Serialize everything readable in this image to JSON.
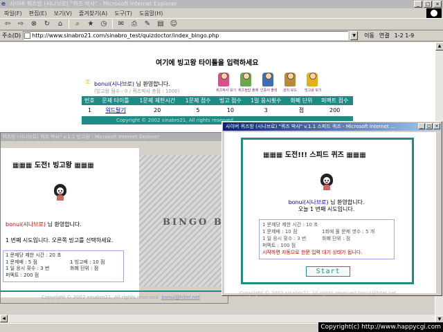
{
  "browser": {
    "title": "사이버 퀴즈방 (시나브로) \"퀴즈 박사\" - Microsoft Internet Explorer",
    "menu": [
      "파일(F)",
      "편집(E)",
      "보기(V)",
      "즐겨찾기(A)",
      "도구(T)",
      "도움말(H)"
    ],
    "address_label": "주소(D)",
    "address_url": "http://www.sinabro21.com/sinabro_test/quizdoctor/index_bingo.php",
    "go_label": "이동",
    "links_label": "연결",
    "links_extra": "1-2  1-9"
  },
  "main": {
    "title": "여기에 빙고왕 타이틀을 입력하세요",
    "user_name": "bonui(시나브로)",
    "user_greeting_suffix": " 님 환영합니다.",
    "user_score": "(빙고왕 점수 : 0 / 퀴즈박사 총점 : 1000)",
    "icons": [
      {
        "name": "quiz-doctor-icon",
        "label": "퀴즈박사 보기"
      },
      {
        "name": "quiz-answer-icon",
        "label": "퀴즈정답 출제"
      },
      {
        "name": "certificate-icon",
        "label": "인증서 출력"
      },
      {
        "name": "admin-icon",
        "label": "관리 모드"
      },
      {
        "name": "bingo-king-icon",
        "label": "빙고왕 보기"
      }
    ],
    "table": {
      "headers": [
        "번호",
        "문제 타이틀",
        "1문제 제한시간",
        "1문제 점수",
        "빙고 점수",
        "1일 응시횟수",
        "화폐 단위",
        "퍼펙트 점수"
      ],
      "rows": [
        {
          "no": "1",
          "title": "워드탈기",
          "time": "20",
          "score": "5",
          "bingo": "10",
          "daily": "3",
          "unit": "점",
          "perfect": "200"
        }
      ]
    },
    "copyright": "Copyright © 2002 sinabro21, All rights reserved"
  },
  "bingo_window": {
    "title": "퀴즈방 (시나브로) 퀴즈 박사\" v.1.1 빙고왕 - Microsoft Internet Explorer",
    "heading": "▦▦▦ 도전! 빙고왕 ▦▦▦",
    "welcome_name": "bonui(시나브로)",
    "welcome_suffix": " 님 환영합니다.",
    "info": "1 번째 시도입니다. 오른쪽 빙고를 선택하세요.",
    "box_lines": [
      {
        "a": "1 문제당 제한 시간 : 20 초",
        "b": ""
      },
      {
        "a": "1 문제배 : 5 점",
        "b": "1 빙고배 : 10 점"
      },
      {
        "a": "1 일 응시 횟수 : 3 번",
        "b": "화폐 단위 : 점"
      },
      {
        "a": "퍼펙트 : 200 점",
        "b": ""
      }
    ],
    "image_text": "BINGO B",
    "copyright": "Copyright © 2002 sinabro21, All rights reserved",
    "copyright_link": "bonui@hitel.net"
  },
  "speed_window": {
    "title": "사이버 퀴즈방 (시나브로) \"퀴즈 박사\" v.1.1 스피드 퀴즈 - Microsoft Internet ...",
    "heading": "▦▦▦ 도전!!! 스피드 퀴즈 ▦▦▦",
    "welcome_name": "bonui(시나브로)",
    "welcome_suffix": " 님 환영합니다.",
    "today": "오늘 1 번째 시도입니다.",
    "box_lines": [
      {
        "a": "1 문제당 제한 시간 : 10 초",
        "b": ""
      },
      {
        "a": "1 문제배 : 10 점",
        "b": "1회에 풀 문제 갯수 : 5 개"
      },
      {
        "a": "1 일 응시 횟수 : 3 번",
        "b": "화폐 단위 : 점"
      },
      {
        "a": "퍼펙트 : 100 점",
        "b": ""
      }
    ],
    "warning": "시작하면 자동으로 한문 입력 대기 상태가 됩니다.",
    "start_label": "Start",
    "copyright": "Copyright © 2002 sinabro21, All rights reserved  bonui@hitel.net"
  },
  "watermark": "Copyright(c) http://www.happycgi.com",
  "colors": {
    "teal": "#1e8c84",
    "link": "#0000cc",
    "warn": "#cc0000"
  }
}
